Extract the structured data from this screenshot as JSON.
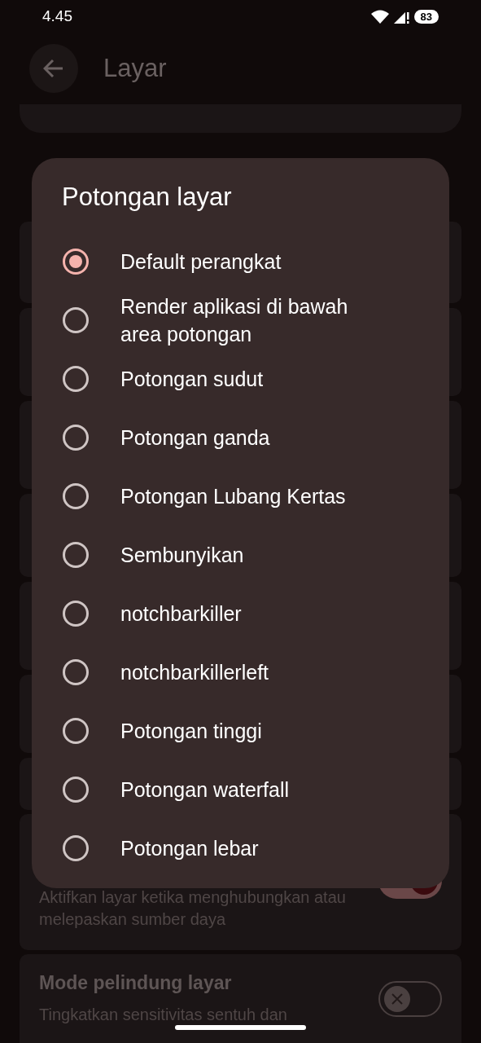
{
  "status_bar": {
    "time": "4.45",
    "battery": "83"
  },
  "app_bar": {
    "title": "Layar"
  },
  "settings": [
    {
      "kind": "toggle",
      "description": "Aktifkan layar ketika menghubungkan atau melepaskan sumber daya",
      "on": true
    },
    {
      "kind": "toggle",
      "title": "Mode pelindung layar",
      "description": "Tingkatkan sensitivitas sentuh dan",
      "on": false
    }
  ],
  "dialog": {
    "title": "Potongan layar",
    "options": [
      {
        "label": "Default perangkat",
        "selected": true
      },
      {
        "label": "Render aplikasi di bawah area potongan",
        "selected": false
      },
      {
        "label": "Potongan sudut",
        "selected": false
      },
      {
        "label": "Potongan ganda",
        "selected": false
      },
      {
        "label": "Potongan Lubang Kertas",
        "selected": false
      },
      {
        "label": "Sembunyikan",
        "selected": false
      },
      {
        "label": "notchbarkiller",
        "selected": false
      },
      {
        "label": "notchbarkillerleft",
        "selected": false
      },
      {
        "label": "Potongan tinggi",
        "selected": false
      },
      {
        "label": "Potongan waterfall",
        "selected": false
      },
      {
        "label": "Potongan lebar",
        "selected": false
      }
    ]
  }
}
